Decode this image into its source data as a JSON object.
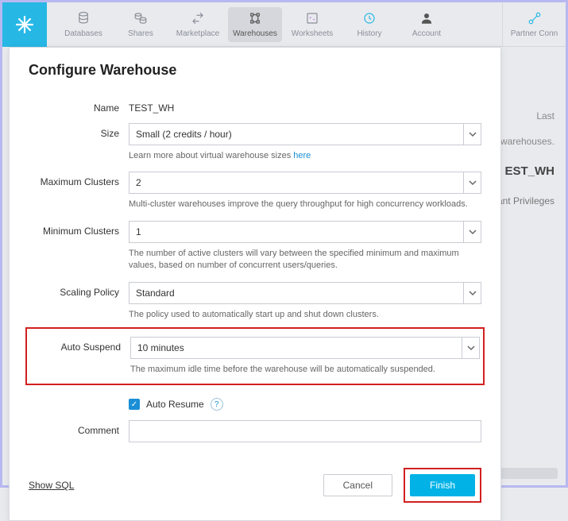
{
  "nav": {
    "items": [
      {
        "label": "Databases"
      },
      {
        "label": "Shares"
      },
      {
        "label": "Marketplace"
      },
      {
        "label": "Warehouses"
      },
      {
        "label": "Worksheets"
      },
      {
        "label": "History"
      },
      {
        "label": "Account"
      }
    ],
    "partner": "Partner Conn"
  },
  "bg": {
    "last": "Last",
    "warehouses": "warehouses.",
    "wh_name": "EST_WH",
    "grant": "Grant Privileges"
  },
  "modal": {
    "title": "Configure Warehouse",
    "name_label": "Name",
    "name_value": "TEST_WH",
    "size_label": "Size",
    "size_value": "Small  (2 credits / hour)",
    "size_helper_prefix": "Learn more about virtual warehouse sizes ",
    "size_helper_link": "here",
    "max_label": "Maximum Clusters",
    "max_value": "2",
    "max_helper": "Multi-cluster warehouses improve the query throughput for high concurrency workloads.",
    "min_label": "Minimum Clusters",
    "min_value": "1",
    "min_helper": "The number of active clusters will vary between the specified minimum and maximum values, based on number of concurrent users/queries.",
    "scaling_label": "Scaling Policy",
    "scaling_value": "Standard",
    "scaling_helper": "The policy used to automatically start up and shut down clusters.",
    "suspend_label": "Auto Suspend",
    "suspend_value": "10 minutes",
    "suspend_helper": "The maximum idle time before the warehouse will be automatically suspended.",
    "auto_resume_label": "Auto Resume",
    "comment_label": "Comment",
    "show_sql": "Show SQL",
    "cancel": "Cancel",
    "finish": "Finish"
  }
}
